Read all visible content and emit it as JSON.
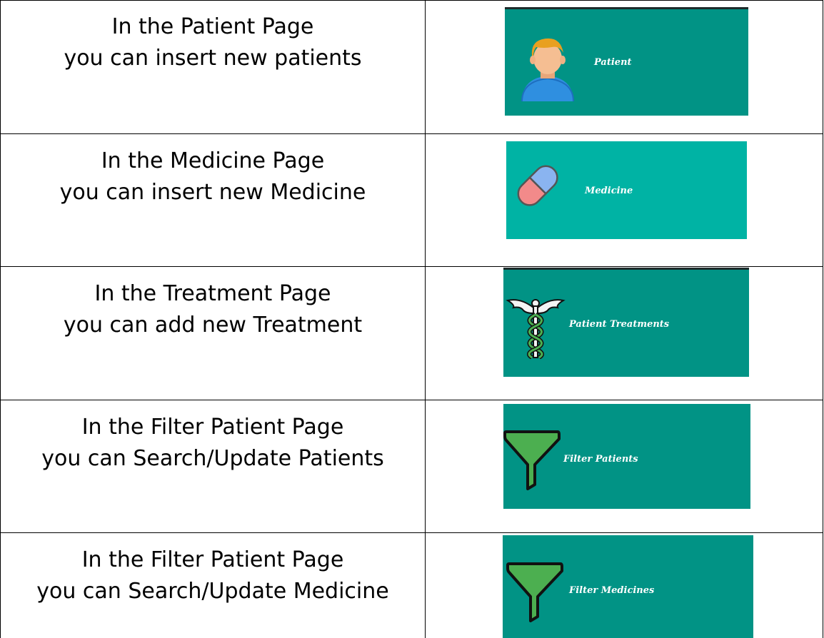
{
  "rows": [
    {
      "line1": "In the Patient Page",
      "line2": "you can insert new patients",
      "button_label": "Patient",
      "icon": "person-icon",
      "color": "#019385"
    },
    {
      "line1": "In the Medicine Page",
      "line2": "you can insert new Medicine",
      "button_label": "Medicine",
      "icon": "pill-icon",
      "color": "#00b3a4"
    },
    {
      "line1": "In the Treatment Page",
      "line2": "you can add new Treatment",
      "button_label": "Patient Treatments",
      "icon": "caduceus-icon",
      "color": "#019385"
    },
    {
      "line1": "In the Filter Patient Page",
      "line2": "you can Search/Update Patients",
      "button_label": "Filter Patients",
      "icon": "funnel-icon",
      "color": "#019385"
    },
    {
      "line1": "In the Filter Patient Page",
      "line2": "you can Search/Update Medicine",
      "button_label": "Filter Medicines",
      "icon": "funnel-icon",
      "color": "#019385"
    }
  ]
}
